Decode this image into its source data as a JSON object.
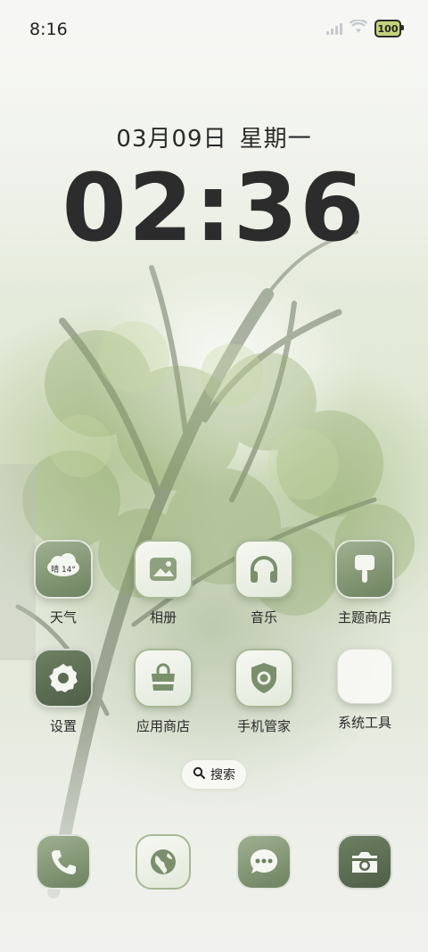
{
  "status_bar": {
    "time": "8:16",
    "battery": "100",
    "icons": [
      "signal-icon",
      "wifi-icon",
      "battery-icon"
    ]
  },
  "lockscreen": {
    "date": "03月09日",
    "weekday": "星期一",
    "clock": "02:36"
  },
  "apps": [
    {
      "label": "天气",
      "icon": "weather-icon",
      "detail": "晴 14°"
    },
    {
      "label": "相册",
      "icon": "photo-icon"
    },
    {
      "label": "音乐",
      "icon": "headphones-icon"
    },
    {
      "label": "主题商店",
      "icon": "paint-brush-icon"
    },
    {
      "label": "设置",
      "icon": "gear-icon"
    },
    {
      "label": "应用商店",
      "icon": "shopping-bag-icon"
    },
    {
      "label": "手机管家",
      "icon": "shield-icon"
    },
    {
      "label": "系统工具",
      "icon": "folder-icon"
    }
  ],
  "search": {
    "label": "搜索"
  },
  "dock": [
    {
      "icon": "phone-icon"
    },
    {
      "icon": "browser-icon"
    },
    {
      "icon": "messages-icon"
    },
    {
      "icon": "camera-icon"
    }
  ],
  "colors": {
    "icon_dark": "#7b8f6c",
    "icon_light": "#eef2e8",
    "text": "#2a2a2a"
  }
}
